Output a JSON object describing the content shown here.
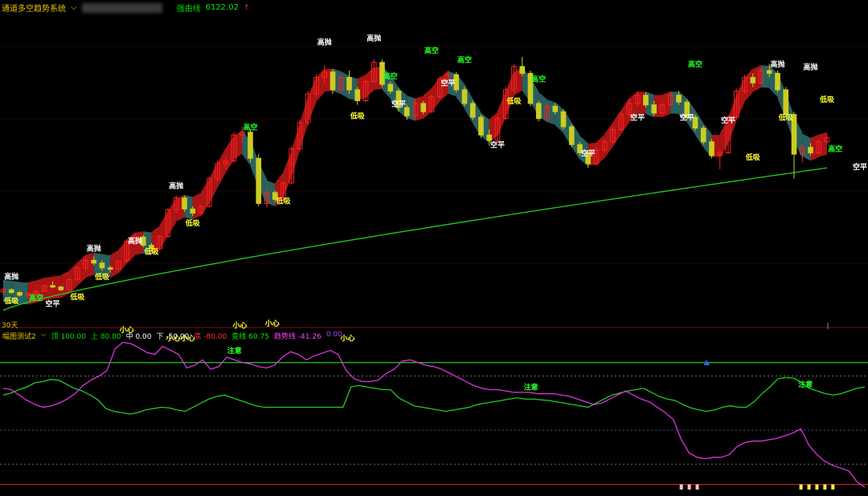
{
  "header": {
    "title": "通道多空趋势系统",
    "indicator_label": "强由线",
    "indicator_value": "6122.02"
  },
  "period_label": "30天",
  "sub_header": {
    "title": "幅图测试2",
    "items": [
      {
        "label": "顶",
        "value": "100.00",
        "color": "#00dd00"
      },
      {
        "label": "上",
        "value": "80.00",
        "color": "#00dd00"
      },
      {
        "label": "中",
        "value": "0.00",
        "color": "#ffffff"
      },
      {
        "label": "下",
        "value": "-50.00",
        "color": "#ffffff"
      },
      {
        "label": "底",
        "value": "-80.00",
        "color": "#ff3030"
      },
      {
        "label": "变线",
        "value": "60.75",
        "color": "#00ee00"
      },
      {
        "label": "趋势线",
        "value": "-41.26",
        "color": "#ff40ff"
      },
      {
        "label": "",
        "value": "0.00",
        "color": "#a040ff"
      }
    ]
  },
  "chart_data": {
    "type": "candlestick",
    "colors": {
      "bull_band": "#c81818",
      "bear_band": "#2f7070",
      "long_ma": "#22cc22",
      "osc_green": "#22cc22",
      "osc_magenta": "#dd33dd",
      "up_candle": "#ff2020",
      "down_candle": "#cccc20"
    },
    "candles": [
      [
        4.5,
        5.1,
        4.0,
        4.8
      ],
      [
        4.8,
        5.0,
        4.2,
        4.4
      ],
      [
        4.4,
        4.6,
        3.8,
        4.0
      ],
      [
        4.0,
        4.4,
        3.6,
        4.3
      ],
      [
        4.3,
        4.7,
        4.1,
        4.6
      ],
      [
        4.6,
        5.6,
        4.5,
        5.4
      ],
      [
        5.4,
        6.0,
        5.0,
        5.2
      ],
      [
        5.2,
        5.4,
        4.6,
        4.8
      ],
      [
        4.8,
        6.5,
        4.8,
        6.3
      ],
      [
        6.3,
        8.2,
        6.0,
        8.0
      ],
      [
        8.0,
        9.4,
        7.6,
        9.1
      ],
      [
        9.1,
        9.7,
        8.4,
        8.7
      ],
      [
        8.7,
        9.1,
        7.6,
        8.0
      ],
      [
        8.0,
        8.3,
        7.3,
        7.8
      ],
      [
        7.8,
        9.1,
        7.7,
        9.0
      ],
      [
        9.0,
        12.2,
        8.8,
        11.9
      ],
      [
        11.9,
        13.1,
        11.4,
        12.5
      ],
      [
        12.5,
        12.8,
        11.0,
        11.3
      ],
      [
        11.3,
        11.6,
        10.4,
        10.8
      ],
      [
        10.8,
        12.8,
        10.6,
        12.6
      ],
      [
        12.6,
        16.8,
        12.4,
        16.5
      ],
      [
        16.5,
        18.6,
        16.0,
        18.2
      ],
      [
        18.2,
        18.5,
        16.2,
        16.6
      ],
      [
        16.6,
        17.0,
        15.6,
        16.0
      ],
      [
        16.0,
        17.2,
        15.8,
        17.0
      ],
      [
        17.0,
        21.2,
        16.8,
        21.0
      ],
      [
        21.0,
        23.6,
        20.6,
        23.2
      ],
      [
        23.2,
        24.2,
        22.4,
        23.6
      ],
      [
        23.6,
        27.8,
        23.4,
        27.4
      ],
      [
        27.4,
        28.6,
        26.2,
        27.8
      ],
      [
        27.8,
        28.2,
        23.4,
        24.0
      ],
      [
        24.0,
        24.6,
        17.0,
        17.4
      ],
      [
        17.4,
        19.6,
        16.8,
        19.0
      ],
      [
        19.0,
        19.3,
        17.6,
        18.0
      ],
      [
        18.0,
        20.6,
        17.8,
        20.4
      ],
      [
        20.4,
        25.8,
        20.2,
        25.4
      ],
      [
        25.4,
        29.6,
        25.0,
        29.2
      ],
      [
        29.2,
        33.8,
        28.8,
        33.4
      ],
      [
        33.4,
        36.2,
        33.0,
        35.8
      ],
      [
        35.8,
        37.6,
        34.8,
        36.6
      ],
      [
        36.6,
        37.0,
        33.4,
        34.0
      ],
      [
        34.0,
        36.2,
        33.6,
        35.8
      ],
      [
        35.8,
        36.8,
        33.4,
        34.0
      ],
      [
        34.0,
        34.4,
        31.8,
        32.4
      ],
      [
        32.4,
        35.6,
        32.2,
        35.2
      ],
      [
        35.2,
        38.4,
        35.0,
        38.0
      ],
      [
        38.0,
        38.4,
        34.4,
        34.8
      ],
      [
        34.8,
        35.2,
        33.4,
        33.8
      ],
      [
        33.8,
        34.2,
        30.8,
        31.4
      ],
      [
        31.4,
        31.8,
        29.6,
        30.2
      ],
      [
        30.2,
        32.6,
        29.6,
        32.0
      ],
      [
        32.0,
        32.4,
        30.4,
        30.8
      ],
      [
        30.8,
        33.4,
        30.6,
        33.0
      ],
      [
        33.0,
        36.0,
        32.6,
        35.6
      ],
      [
        35.6,
        36.8,
        34.4,
        36.2
      ],
      [
        36.2,
        36.6,
        33.6,
        34.0
      ],
      [
        34.0,
        34.4,
        31.6,
        32.0
      ],
      [
        32.0,
        32.4,
        29.6,
        30.0
      ],
      [
        30.0,
        30.4,
        27.0,
        27.4
      ],
      [
        27.4,
        28.2,
        25.8,
        26.6
      ],
      [
        26.6,
        30.2,
        26.4,
        29.8
      ],
      [
        29.8,
        34.4,
        29.6,
        34.0
      ],
      [
        34.0,
        37.8,
        33.6,
        37.4
      ],
      [
        37.4,
        38.8,
        36.0,
        36.4
      ],
      [
        36.4,
        36.8,
        31.6,
        32.0
      ],
      [
        32.0,
        32.4,
        29.4,
        29.8
      ],
      [
        29.8,
        32.0,
        29.4,
        31.6
      ],
      [
        31.6,
        32.0,
        30.4,
        30.8
      ],
      [
        30.8,
        31.2,
        28.2,
        28.6
      ],
      [
        28.6,
        29.0,
        25.6,
        26.0
      ],
      [
        26.0,
        26.4,
        24.4,
        24.8
      ],
      [
        24.8,
        25.2,
        22.6,
        23.2
      ],
      [
        23.2,
        25.6,
        23.0,
        25.2
      ],
      [
        25.2,
        26.8,
        24.8,
        26.4
      ],
      [
        26.4,
        28.6,
        26.2,
        28.2
      ],
      [
        28.2,
        30.8,
        28.0,
        30.4
      ],
      [
        30.4,
        32.6,
        30.0,
        32.0
      ],
      [
        32.0,
        33.8,
        31.6,
        33.2
      ],
      [
        33.2,
        33.6,
        31.4,
        31.8
      ],
      [
        31.8,
        32.4,
        30.2,
        30.6
      ],
      [
        30.6,
        32.2,
        30.4,
        31.8
      ],
      [
        31.8,
        33.6,
        31.6,
        33.2
      ],
      [
        33.2,
        33.8,
        31.8,
        32.2
      ],
      [
        32.2,
        32.6,
        29.6,
        30.0
      ],
      [
        30.0,
        30.4,
        28.0,
        28.4
      ],
      [
        28.4,
        28.8,
        26.0,
        26.4
      ],
      [
        26.4,
        26.8,
        24.0,
        24.4
      ],
      [
        24.4,
        25.2,
        22.4,
        24.8
      ],
      [
        24.8,
        30.4,
        24.6,
        30.0
      ],
      [
        30.0,
        34.2,
        29.8,
        33.8
      ],
      [
        33.8,
        36.2,
        33.4,
        35.8
      ],
      [
        35.8,
        36.4,
        34.4,
        35.0
      ],
      [
        35.0,
        37.2,
        34.8,
        36.8
      ],
      [
        36.8,
        37.8,
        35.8,
        36.4
      ],
      [
        36.4,
        36.8,
        33.6,
        34.0
      ],
      [
        34.0,
        34.4,
        30.0,
        30.4
      ],
      [
        30.4,
        30.8,
        21.0,
        24.6
      ],
      [
        24.6,
        26.0,
        23.4,
        25.6
      ],
      [
        25.6,
        26.2,
        24.4,
        24.8
      ],
      [
        24.8,
        26.8,
        24.6,
        26.4
      ],
      [
        26.4,
        27.4,
        26.0,
        27.0
      ]
    ],
    "long_ma": {
      "y_start": 1.8,
      "y_end": 22.6
    },
    "price_labels": [
      {
        "text": "高抛",
        "i": 1,
        "y": 6.4,
        "color": "#ffffff"
      },
      {
        "text": "低吸",
        "i": 1,
        "y": 2.8,
        "color": "#ffff33"
      },
      {
        "text": "高空",
        "i": 4,
        "y": 3.3,
        "color": "#22ff22"
      },
      {
        "text": "空平",
        "i": 6,
        "y": 2.4,
        "color": "#ffffff"
      },
      {
        "text": "低吸",
        "i": 9,
        "y": 3.4,
        "color": "#ffff33"
      },
      {
        "text": "高抛",
        "i": 11,
        "y": 10.5,
        "color": "#ffffff"
      },
      {
        "text": "低吸",
        "i": 12,
        "y": 6.3,
        "color": "#ffff33"
      },
      {
        "text": "高抛",
        "i": 16,
        "y": 11.6,
        "color": "#ffffff"
      },
      {
        "text": "低吸",
        "i": 18,
        "y": 10.0,
        "color": "#ffff33"
      },
      {
        "text": "高抛",
        "i": 21,
        "y": 19.6,
        "color": "#ffffff"
      },
      {
        "text": "低吸",
        "i": 23,
        "y": 14.2,
        "color": "#ffff33"
      },
      {
        "text": "高空",
        "i": 30,
        "y": 28.2,
        "color": "#22ff22"
      },
      {
        "text": "低吸",
        "i": 34,
        "y": 17.4,
        "color": "#ffff33"
      },
      {
        "text": "高抛",
        "i": 39,
        "y": 40.6,
        "color": "#ffffff"
      },
      {
        "text": "低吸",
        "i": 43,
        "y": 29.8,
        "color": "#ffff33"
      },
      {
        "text": "高抛",
        "i": 45,
        "y": 41.2,
        "color": "#ffffff"
      },
      {
        "text": "高空",
        "i": 47,
        "y": 35.6,
        "color": "#22ff22"
      },
      {
        "text": "空平",
        "i": 48,
        "y": 31.6,
        "color": "#ffffff"
      },
      {
        "text": "高空",
        "i": 52,
        "y": 39.4,
        "color": "#22ff22"
      },
      {
        "text": "高空",
        "i": 56,
        "y": 38.0,
        "color": "#22ff22"
      },
      {
        "text": "空平",
        "i": 54,
        "y": 34.6,
        "color": "#ffffff"
      },
      {
        "text": "空平",
        "i": 60,
        "y": 25.6,
        "color": "#ffffff"
      },
      {
        "text": "低吸",
        "i": 62,
        "y": 32.0,
        "color": "#ffff33"
      },
      {
        "text": "高空",
        "i": 65,
        "y": 35.2,
        "color": "#22ff22"
      },
      {
        "text": "空平",
        "i": 71,
        "y": 24.4,
        "color": "#ffffff"
      },
      {
        "text": "空平",
        "i": 77,
        "y": 29.6,
        "color": "#ffffff"
      },
      {
        "text": "高空",
        "i": 84,
        "y": 37.4,
        "color": "#22ff22"
      },
      {
        "text": "空平",
        "i": 83,
        "y": 29.6,
        "color": "#ffffff"
      },
      {
        "text": "空平",
        "i": 88,
        "y": 29.2,
        "color": "#ffffff"
      },
      {
        "text": "低吸",
        "i": 91,
        "y": 23.8,
        "color": "#ffff33"
      },
      {
        "text": "高抛",
        "i": 94,
        "y": 37.4,
        "color": "#ffffff"
      },
      {
        "text": "低吸",
        "i": 95,
        "y": 29.6,
        "color": "#ffff33"
      },
      {
        "text": "高抛",
        "i": 98,
        "y": 37.0,
        "color": "#ffffff"
      },
      {
        "text": "低吸",
        "i": 100,
        "y": 32.2,
        "color": "#ffff33"
      },
      {
        "text": "高空",
        "i": 101,
        "y": 25.0,
        "color": "#22ff22"
      },
      {
        "text": "空平",
        "i": 104,
        "y": 22.4,
        "color": "#ffffff"
      }
    ],
    "osc_green": [
      52,
      55,
      60,
      64,
      70,
      72,
      75,
      74,
      68,
      62,
      58,
      52,
      45,
      32,
      28,
      26,
      24,
      26,
      30,
      32,
      34,
      33,
      30,
      28,
      34,
      40,
      46,
      50,
      52,
      48,
      44,
      40,
      36,
      34,
      34,
      34,
      34,
      34,
      34,
      34,
      34,
      34,
      34,
      34,
      64,
      66,
      64,
      62,
      60,
      60,
      48,
      42,
      36,
      34,
      32,
      30,
      28,
      30,
      32,
      34,
      38,
      40,
      42,
      44,
      46,
      48,
      46,
      46,
      45,
      44,
      42,
      40,
      38,
      36,
      34,
      40,
      46,
      52,
      55,
      58,
      60,
      62,
      56,
      50,
      46,
      44,
      38,
      33,
      30,
      28,
      30,
      34,
      36,
      34,
      34,
      42,
      54,
      64,
      76,
      78,
      77,
      70,
      62,
      58,
      54,
      52,
      54,
      58,
      62,
      64
    ],
    "osc_magenta": [
      62,
      60,
      52,
      44,
      38,
      34,
      36,
      40,
      46,
      54,
      66,
      74,
      80,
      88,
      120,
      130,
      128,
      122,
      115,
      112,
      124,
      118,
      112,
      92,
      96,
      104,
      90,
      94,
      108,
      104,
      100,
      98,
      94,
      92,
      96,
      108,
      116,
      112,
      104,
      110,
      114,
      118,
      112,
      88,
      76,
      72,
      72,
      74,
      84,
      90,
      102,
      104,
      100,
      96,
      94,
      90,
      84,
      78,
      72,
      66,
      62,
      60,
      60,
      58,
      56,
      56,
      56,
      54,
      54,
      54,
      52,
      50,
      46,
      42,
      38,
      40,
      46,
      52,
      58,
      52,
      46,
      42,
      34,
      26,
      16,
      -14,
      -34,
      -40,
      -42,
      -40,
      -40,
      -36,
      -24,
      -18,
      -16,
      -16,
      -14,
      -12,
      -8,
      -4,
      2,
      -22,
      -36,
      -46,
      -52,
      -56,
      -60,
      -76,
      -84
    ],
    "osc_labels": [
      {
        "text": "小心",
        "i": 14,
        "y": 145,
        "color": "#ffff33"
      },
      {
        "text": "小心小心",
        "i": 24,
        "y": 132,
        "color": "#ffff33"
      },
      {
        "text": "小心",
        "i": 35,
        "y": 151,
        "color": "#ffff33"
      },
      {
        "text": "小心",
        "i": 41,
        "y": 154,
        "color": "#ffff33"
      },
      {
        "text": "注意",
        "i": 34,
        "y": 114,
        "color": "#22ff22"
      },
      {
        "text": "小心",
        "i": 55,
        "y": 132,
        "color": "#ffff33"
      },
      {
        "text": "注意",
        "i": 98,
        "y": 60,
        "color": "#22ff22"
      },
      {
        "text": "注意",
        "i": 149,
        "y": 64,
        "color": "#22ff22"
      }
    ],
    "osc_levels": [
      100,
      80,
      0,
      -50,
      -80
    ],
    "xlim": [
      0,
      104
    ],
    "ylim_price": [
      0,
      45
    ],
    "ylim_osc": [
      -90,
      140
    ]
  }
}
